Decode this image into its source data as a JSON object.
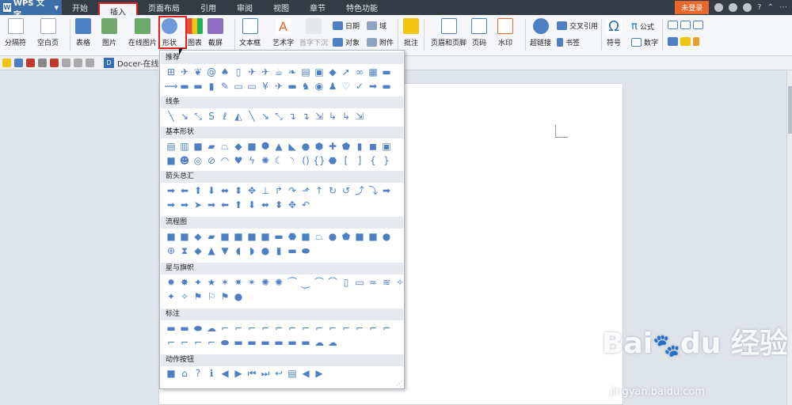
{
  "app": {
    "name": "WPS 文字"
  },
  "menu_tabs": [
    {
      "label": "开始"
    },
    {
      "label": "插入"
    },
    {
      "label": "页面布局"
    },
    {
      "label": "引用"
    },
    {
      "label": "审阅"
    },
    {
      "label": "视图"
    },
    {
      "label": "章节"
    },
    {
      "label": "特色功能"
    }
  ],
  "topright": {
    "login": "未登录",
    "help": "?"
  },
  "ribbon": {
    "page_break": "分隔符",
    "blank_page": "空白页",
    "table": "表格",
    "picture": "图片",
    "online_picture": "在线图片",
    "shapes": "形状",
    "chart": "图表",
    "screenshot": "截屏",
    "textbox": "文本框",
    "wordart": "艺术字",
    "drop_cap": "首字下沉",
    "date": "日期",
    "object": "对象",
    "field": "域",
    "attachment": "附件",
    "comment": "批注",
    "header_footer": "页眉和页脚",
    "page_number": "页码",
    "watermark": "水印",
    "hyperlink": "超链接",
    "crossref": "交叉引用",
    "bookmark": "书签",
    "symbol": "符号",
    "formula": "公式",
    "number": "数字"
  },
  "doc_tab": "Docer-在线",
  "shape_panel": {
    "categories": [
      {
        "label": "推荐"
      },
      {
        "label": "线条"
      },
      {
        "label": "基本形状"
      },
      {
        "label": "箭头总汇"
      },
      {
        "label": "流程图"
      },
      {
        "label": "星与旗帜"
      },
      {
        "label": "标注"
      },
      {
        "label": "动作按钮"
      }
    ]
  },
  "watermark": {
    "brand": "Bai du 经验",
    "url": "jingyan.baidu.com"
  },
  "colors": {
    "accent": "#3c6ea8",
    "highlight": "#e0201f",
    "shape": "#4d7fc4",
    "login": "#e8672a"
  }
}
